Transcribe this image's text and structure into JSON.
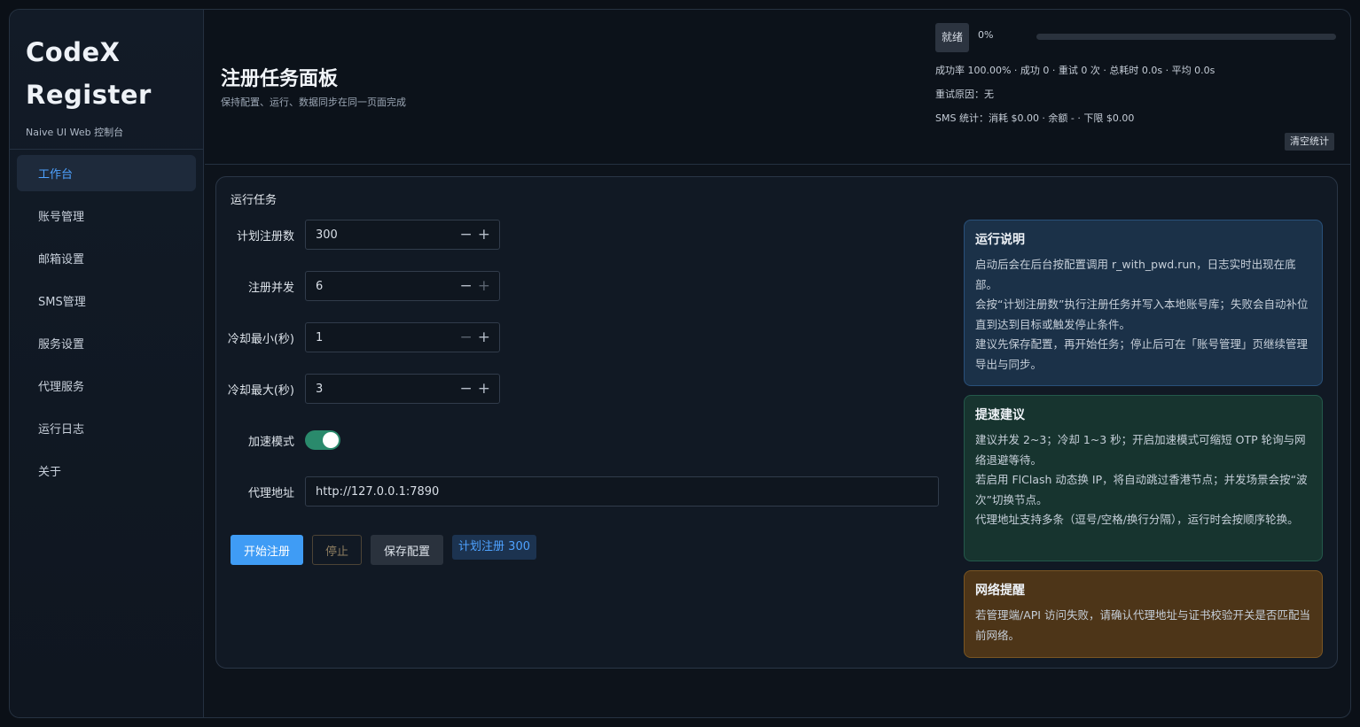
{
  "sidebar": {
    "brand_line1": "CodeX",
    "brand_line2": "Register",
    "brand_sub": "Naive UI Web 控制台",
    "items": [
      {
        "label": "工作台",
        "active": true
      },
      {
        "label": "账号管理"
      },
      {
        "label": "邮箱设置"
      },
      {
        "label": "SMS管理"
      },
      {
        "label": "服务设置"
      },
      {
        "label": "代理服务"
      },
      {
        "label": "运行日志"
      },
      {
        "label": "关于"
      }
    ]
  },
  "header": {
    "title": "注册任务面板",
    "subtitle": "保持配置、运行、数据同步在同一页面完成"
  },
  "status": {
    "state": "就绪",
    "percent": "0%",
    "progress": 0,
    "summary": "成功率 100.00% · 成功 0 · 重试 0 次 · 总耗时 0.0s · 平均 0.0s",
    "retry_reason": "重试原因：无",
    "sms": "SMS 统计：消耗 $0.00 · 余额 - · 下限 $0.00",
    "clear_label": "清空统计"
  },
  "task": {
    "title": "运行任务",
    "fields": {
      "plan_count": {
        "label": "计划注册数",
        "value": "300"
      },
      "concurrency": {
        "label": "注册并发",
        "value": "6"
      },
      "cooldown_min": {
        "label": "冷却最小(秒)",
        "value": "1"
      },
      "cooldown_max": {
        "label": "冷却最大(秒)",
        "value": "3"
      },
      "accel": {
        "label": "加速模式",
        "on": true
      },
      "proxy": {
        "label": "代理地址",
        "value": "http://127.0.0.1:7890"
      }
    },
    "buttons": {
      "start": "开始注册",
      "stop": "停止",
      "save": "保存配置",
      "plan_tag": "计划注册 300"
    }
  },
  "notes": {
    "run": {
      "title": "运行说明",
      "p1": "启动后会在后台按配置调用 r_with_pwd.run，日志实时出现在底部。",
      "p2": "会按“计划注册数”执行注册任务并写入本地账号库；失败会自动补位直到达到目标或触发停止条件。",
      "p3": "建议先保存配置，再开始任务；停止后可在「账号管理」页继续管理导出与同步。"
    },
    "speed": {
      "title": "提速建议",
      "p1": "建议并发 2~3；冷却 1~3 秒；开启加速模式可缩短 OTP 轮询与网络退避等待。",
      "p2": "若启用 FlClash 动态换 IP，将自动跳过香港节点；并发场景会按“波次”切换节点。",
      "p3": "代理地址支持多条（逗号/空格/换行分隔），运行时会按顺序轮换。"
    },
    "network": {
      "title": "网络提醒",
      "p1": "若管理端/API 访问失败，请确认代理地址与证书校验开关是否匹配当前网络。"
    }
  }
}
